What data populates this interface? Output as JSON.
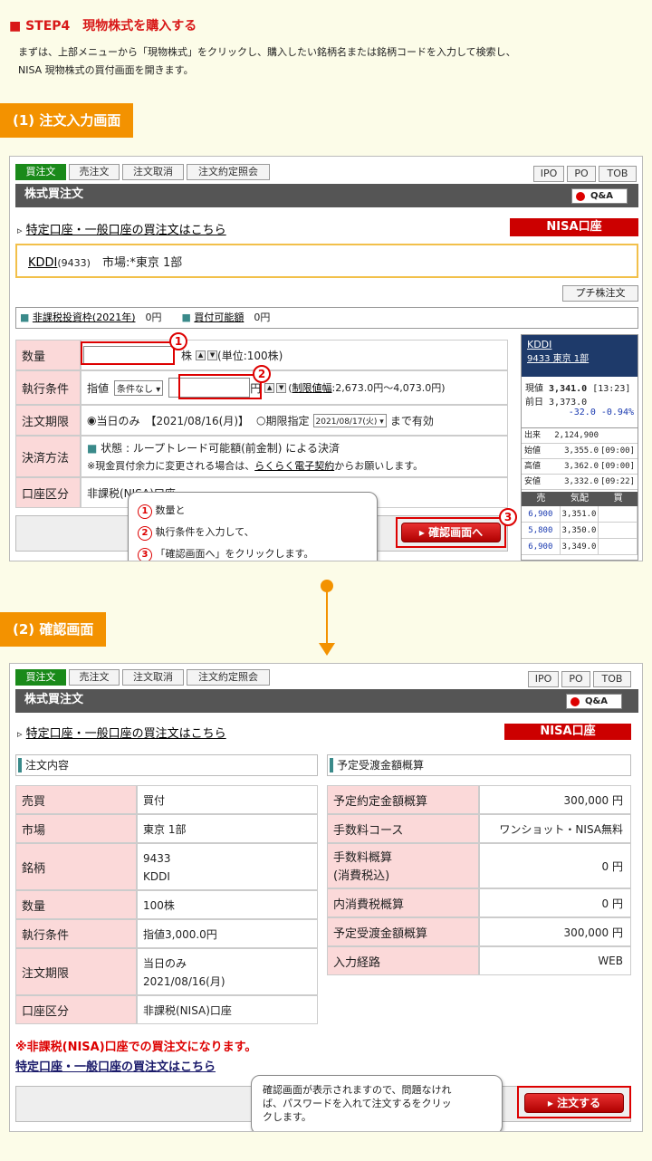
{
  "step": {
    "title": "■ STEP4　現物株式を購入する",
    "desc_line1": "まずは、上部メニューから「現物株式」をクリックし、購入したい銘柄名または銘柄コードを入力して検索し、",
    "desc_line2": "NISA 現物株式の買付画面を開きます。"
  },
  "section1": {
    "label": "(1) 注文入力画面"
  },
  "section2": {
    "label": "(2) 確認画面"
  },
  "tabs": [
    "買注文",
    "売注文",
    "注文取消",
    "注文約定照会"
  ],
  "right_tabs": [
    "IPO",
    "PO",
    "TOB"
  ],
  "header_title": "株式買注文",
  "qa_label": "Q&A",
  "special_link": "特定口座・一般口座の買注文はこちら",
  "nisa_badge": "NISA口座",
  "stock": {
    "name": "KDDI",
    "code": "(9433)",
    "market": "市場:*東京 1部"
  },
  "puchi_button": "プチ株注文",
  "limits": {
    "label1": "非課税投資枠(2021年)",
    "val1": "0円",
    "label2": "買付可能額",
    "val2": "0円"
  },
  "form": {
    "qty_label": "数量",
    "qty_unit": "株",
    "qty_note": "(単位:100株)",
    "exec_label": "執行条件",
    "exec_type": "指値",
    "exec_select": "条件なし",
    "exec_unit": "円",
    "limit_link": "制限値幅",
    "limit_range": ":2,673.0円〜4,073.0円)",
    "period_label": "注文期限",
    "period_today": "当日のみ",
    "period_date": "【2021/08/16(月)】",
    "period_spec": "期限指定",
    "period_select": "2021/08/17(火)",
    "period_until": "まで有効",
    "settle_label": "決済方法",
    "settle_text": "状態 : ループトレード可能額(前金制) による決済",
    "settle_note1": "※現金買付余力に変更される場合は、",
    "settle_link": "らくらく電子契約",
    "settle_note2": "からお願いします。",
    "acct_label": "口座区分",
    "acct_value": "非課税(NISA)口座"
  },
  "quote": {
    "name": "KDDI",
    "sub": "9433 東京 1部",
    "now_label": "現値",
    "now": "3,341.0",
    "now_time": "[13:23]",
    "prev_label": "前日",
    "prev": "3,373.0",
    "change": "-32.0",
    "change_pct": "-0.94%",
    "rows": [
      [
        "出来",
        "2,124,900",
        ""
      ],
      [
        "始値",
        "3,355.0",
        "[09:00]"
      ],
      [
        "高値",
        "3,362.0",
        "[09:00]"
      ],
      [
        "安値",
        "3,332.0",
        "[09:22]"
      ]
    ],
    "board_head": [
      "売",
      "気配",
      "買"
    ],
    "board": [
      [
        "6,900",
        "3,351.0",
        ""
      ],
      [
        "5,800",
        "3,350.0",
        ""
      ],
      [
        "6,900",
        "3,349.0",
        ""
      ]
    ]
  },
  "callout1": {
    "n1": "1",
    "t1": "数量と",
    "n2": "2",
    "t2": "執行条件を入力して、",
    "n3": "3",
    "t3": "「確認画面へ」をクリックします。"
  },
  "confirm_button": "確認画面へ",
  "markers": {
    "m1": "1",
    "m2": "2",
    "m3": "3"
  },
  "confirm": {
    "left_head": "注文内容",
    "right_head": "予定受渡金額概算",
    "left": [
      [
        "売買",
        "買付"
      ],
      [
        "市場",
        "東京 1部"
      ],
      [
        "銘柄",
        "9433",
        "KDDI"
      ],
      [
        "数量",
        "100株"
      ],
      [
        "執行条件",
        "指値3,000.0円"
      ],
      [
        "注文期限",
        "当日のみ",
        "2021/08/16(月)"
      ],
      [
        "口座区分",
        "非課税(NISA)口座"
      ]
    ],
    "right": [
      [
        "予定約定金額概算",
        "300,000 円"
      ],
      [
        "手数料コース",
        "ワンショット・NISA無料"
      ],
      [
        "手数料概算",
        "(消費税込)",
        "0 円"
      ],
      [
        "内消費税概算",
        "0 円"
      ],
      [
        "予定受渡金額概算",
        "300,000 円"
      ],
      [
        "入力経路",
        "WEB"
      ]
    ],
    "warning": "※非課税(NISA)口座での買注文になります。",
    "bottom_link": "特定口座・一般口座の買注文はこちら",
    "callout_line1": "確認画面が表示されますので、問題なけれ",
    "callout_line2": "ば、パスワードを入れて注文するをクリッ",
    "callout_line3": "クします。",
    "order_button": "注文する"
  },
  "colors": {
    "accent": "#f39200",
    "nisa": "#cc0000",
    "tab_active": "#1a8a1a"
  }
}
